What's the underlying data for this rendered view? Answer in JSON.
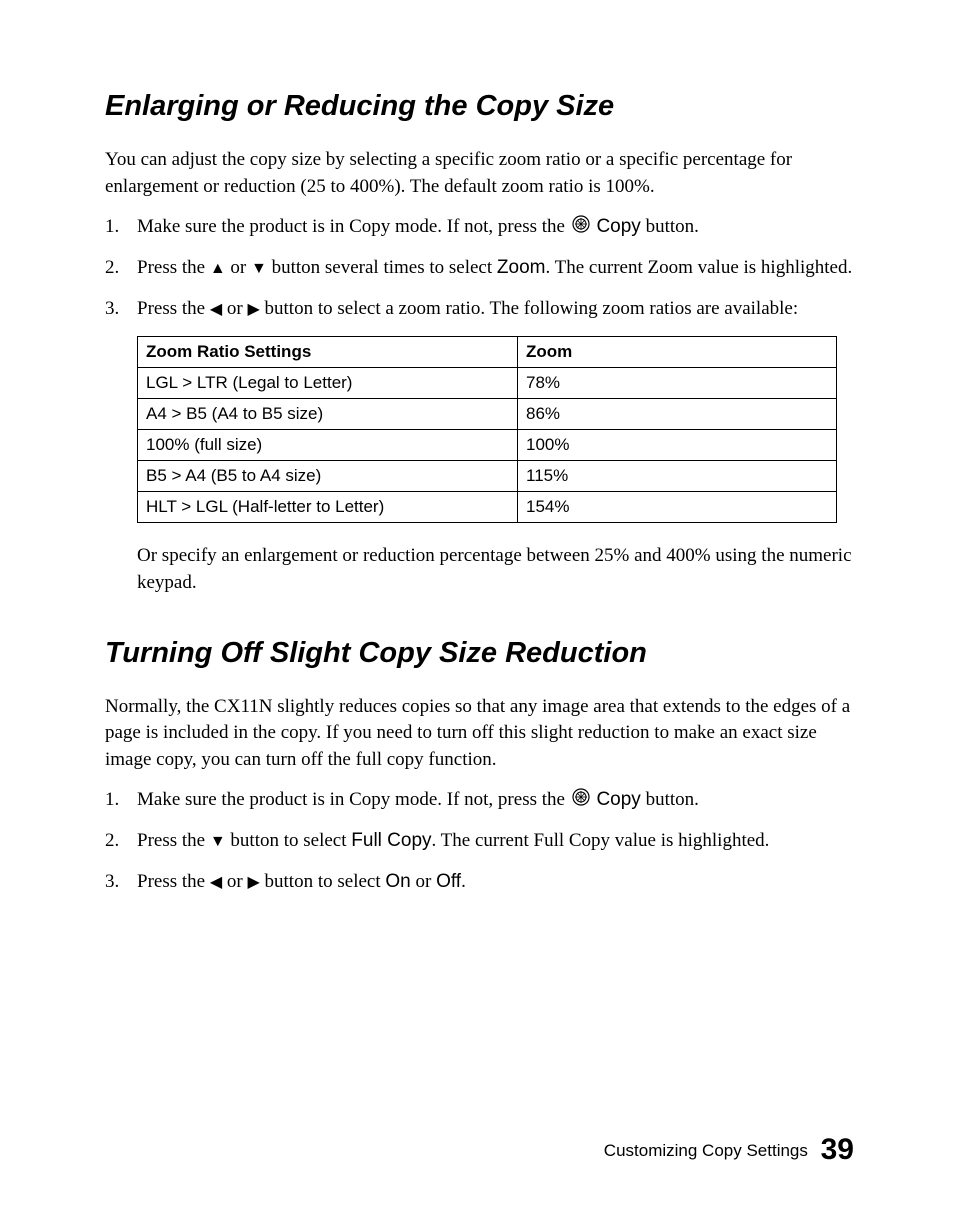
{
  "section1": {
    "heading": "Enlarging or Reducing the Copy Size",
    "intro": "You can adjust the copy size by selecting a specific zoom ratio or a specific percentage for enlargement or reduction (25 to 400%). The default zoom ratio is 100%.",
    "step1_num": "1.",
    "step1_a": "Make sure the product is in Copy mode. If not, press the ",
    "step1_copy": "Copy",
    "step1_b": " button.",
    "step2_num": "2.",
    "step2_a": "Press the ",
    "step2_b": " or ",
    "step2_c": " button several times to select ",
    "step2_zoom": "Zoom",
    "step2_d": ". The current Zoom value is highlighted.",
    "step3_num": "3.",
    "step3_a": "Press the ",
    "step3_b": " or ",
    "step3_c": " button to select a zoom ratio. The following zoom ratios are available:",
    "step3_note": "Or specify an enlargement or reduction percentage between 25% and 400% using the numeric keypad."
  },
  "chart_data": {
    "type": "table",
    "headers": [
      "Zoom Ratio Settings",
      "Zoom"
    ],
    "rows": [
      {
        "setting": "LGL > LTR (Legal to Letter)",
        "zoom": "78%"
      },
      {
        "setting": "A4 > B5 (A4 to B5 size)",
        "zoom": "86%"
      },
      {
        "setting": "100% (full size)",
        "zoom": "100%"
      },
      {
        "setting": "B5 > A4 (B5 to A4 size)",
        "zoom": "115%"
      },
      {
        "setting": "HLT > LGL (Half-letter to Letter)",
        "zoom": "154%"
      }
    ]
  },
  "section2": {
    "heading": "Turning Off Slight Copy Size Reduction",
    "intro": "Normally, the CX11N slightly reduces copies so that any image area that extends to the edges of a page is included in the copy. If you need to turn off this slight reduction to make an exact size image copy, you can turn off the full copy function.",
    "step1_num": "1.",
    "step1_a": "Make sure the product is in Copy mode. If not, press the ",
    "step1_copy": "Copy",
    "step1_b": " button.",
    "step2_num": "2.",
    "step2_a": "Press the ",
    "step2_b": " button to select ",
    "step2_fullcopy": "Full Copy",
    "step2_c": ". The current Full Copy value is highlighted.",
    "step3_num": "3.",
    "step3_a": "Press the ",
    "step3_b": " or ",
    "step3_c": " button to select ",
    "step3_on": "On",
    "step3_d": " or ",
    "step3_off": "Off",
    "step3_e": "."
  },
  "footer": {
    "label": "Customizing Copy Settings",
    "page": "39"
  }
}
